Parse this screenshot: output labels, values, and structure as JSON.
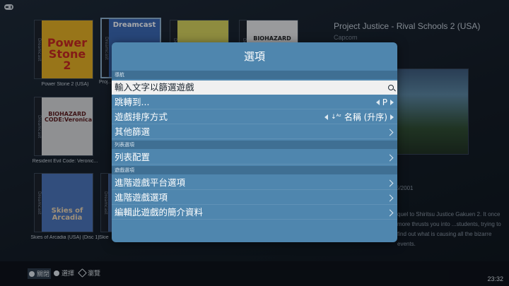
{
  "grid": {
    "tiles": [
      {
        "caption": "Power Stone 2 (USA)",
        "art": "Power Stone 2",
        "spine": "Dreamcast",
        "color": "#e7b01f"
      },
      {
        "caption": "Project Justice - Rival Schools 2 (USA)",
        "art": "Dreamcast",
        "spine": "Dreamcast",
        "color": "#3a67b3"
      },
      {
        "caption": "",
        "art": "",
        "spine": "Dreamcast",
        "color": "#d8d35a"
      },
      {
        "caption": "",
        "art": "BIOHAZARD",
        "spine": "Dreamcast",
        "color": "#e9e9e9"
      },
      {
        "caption": "Resident Evil Code: Veronic...",
        "art": "BIOHAZARD CODE:Veronica",
        "spine": "Dreamcast",
        "color": "#d9d9d9"
      },
      {
        "caption": "Skies of Arcadia (USA) (Disc 1)",
        "art": "Skies of Arcadia",
        "spine": "Dreamcast",
        "color": "#4b73b8"
      },
      {
        "caption": "Skie",
        "art": "",
        "spine": "Dreamcast",
        "color": "#4b6fa8"
      }
    ]
  },
  "info": {
    "title": "Project Justice - Rival Schools 2 (USA)",
    "developer": "Capcom",
    "date_fragment": "5/2001",
    "description": "quel to Shiritsu Justice Gakuen 2. It once more thrusts you into ...students, trying to find out what is causing all the bizarre events."
  },
  "dialog": {
    "title": "選項",
    "sections": {
      "navigation": "導航",
      "list": "列表選項",
      "game": "遊戲選項"
    },
    "rows": {
      "filter": "輸入文字以篩選遊戲",
      "jump": "跳轉到...",
      "jump_value": "P",
      "sort": "遊戲排序方式",
      "sort_value": "名稱 (升序)",
      "other_filter": "其他篩選",
      "list_config": "列表配置",
      "platform_options": "進階遊戲平台選項",
      "game_options": "進階遊戲選項",
      "edit_metadata": "編輯此遊戲的簡介資料"
    }
  },
  "footer": {
    "close": "關閉",
    "select": "選擇",
    "browse": "瀏覽",
    "clock": "23:32"
  },
  "colors": {
    "dialog_bg": "#4f86ae",
    "section_bg": "#3f6f93",
    "selected_bg": "#f0f0f0"
  }
}
